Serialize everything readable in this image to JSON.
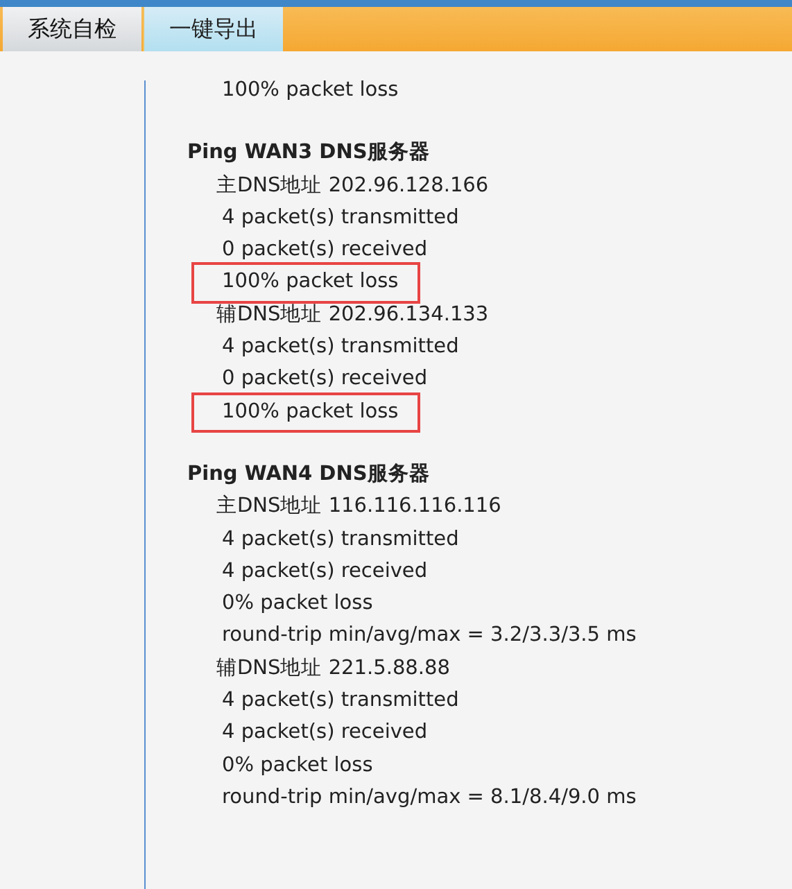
{
  "tabs": [
    {
      "label": "系统自检",
      "selected": true
    },
    {
      "label": "一键导出",
      "selected": false
    }
  ],
  "lines": [
    {
      "kind": "result",
      "text": "100% packet loss",
      "highlighted": false
    },
    {
      "kind": "heading",
      "text": "Ping WAN3 DNS服务器",
      "highlighted": false
    },
    {
      "kind": "address",
      "text": "主DNS地址 202.96.128.166",
      "highlighted": false
    },
    {
      "kind": "result",
      "text": "4 packet(s) transmitted",
      "highlighted": false
    },
    {
      "kind": "result",
      "text": "0 packet(s) received",
      "highlighted": false
    },
    {
      "kind": "result",
      "text": "100% packet loss",
      "highlighted": true
    },
    {
      "kind": "address",
      "text": "辅DNS地址 202.96.134.133",
      "highlighted": false
    },
    {
      "kind": "result",
      "text": "4 packet(s) transmitted",
      "highlighted": false
    },
    {
      "kind": "result",
      "text": "0 packet(s) received",
      "highlighted": false
    },
    {
      "kind": "result",
      "text": "100% packet loss",
      "highlighted": true
    },
    {
      "kind": "heading",
      "text": "Ping WAN4 DNS服务器",
      "highlighted": false
    },
    {
      "kind": "address",
      "text": "主DNS地址 116.116.116.116",
      "highlighted": false
    },
    {
      "kind": "result",
      "text": "4 packet(s) transmitted",
      "highlighted": false
    },
    {
      "kind": "result",
      "text": "4 packet(s) received",
      "highlighted": false
    },
    {
      "kind": "result",
      "text": "0% packet loss",
      "highlighted": false
    },
    {
      "kind": "result",
      "text": "round-trip min/avg/max = 3.2/3.3/3.5 ms",
      "highlighted": false
    },
    {
      "kind": "address",
      "text": "辅DNS地址 221.5.88.88",
      "highlighted": false
    },
    {
      "kind": "result",
      "text": "4 packet(s) transmitted",
      "highlighted": false
    },
    {
      "kind": "result",
      "text": "4 packet(s) received",
      "highlighted": false
    },
    {
      "kind": "result",
      "text": "0% packet loss",
      "highlighted": false
    },
    {
      "kind": "result",
      "text": "round-trip min/avg/max = 8.1/8.4/9.0 ms",
      "highlighted": false
    }
  ]
}
